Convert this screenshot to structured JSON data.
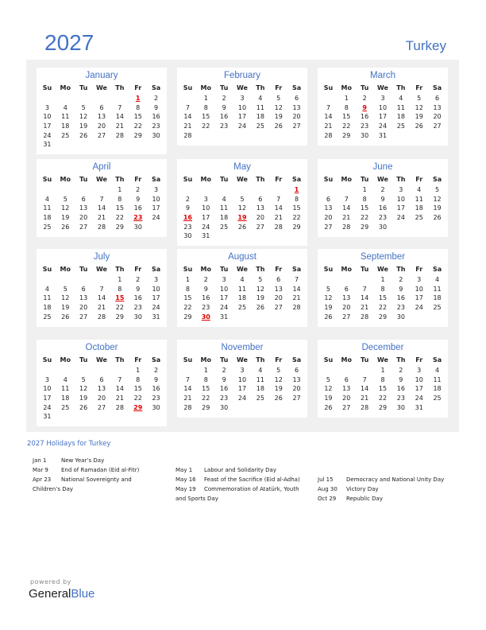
{
  "header": {
    "year": "2027",
    "country": "Turkey"
  },
  "weekdays": [
    "Su",
    "Mo",
    "Tu",
    "We",
    "Th",
    "Fr",
    "Sa"
  ],
  "months": [
    {
      "name": "January",
      "offset": 5,
      "days": 31,
      "holidays": [
        1
      ]
    },
    {
      "name": "February",
      "offset": 1,
      "days": 28,
      "holidays": []
    },
    {
      "name": "March",
      "offset": 1,
      "days": 31,
      "holidays": [
        9
      ]
    },
    {
      "name": "April",
      "offset": 4,
      "days": 30,
      "holidays": [
        23
      ]
    },
    {
      "name": "May",
      "offset": 6,
      "days": 31,
      "holidays": [
        1,
        16,
        19
      ]
    },
    {
      "name": "June",
      "offset": 2,
      "days": 30,
      "holidays": []
    },
    {
      "name": "July",
      "offset": 4,
      "days": 31,
      "holidays": [
        15
      ]
    },
    {
      "name": "August",
      "offset": 0,
      "days": 31,
      "holidays": [
        30
      ]
    },
    {
      "name": "September",
      "offset": 3,
      "days": 30,
      "holidays": []
    },
    {
      "name": "October",
      "offset": 5,
      "days": 31,
      "holidays": [
        29
      ]
    },
    {
      "name": "November",
      "offset": 1,
      "days": 30,
      "holidays": []
    },
    {
      "name": "December",
      "offset": 3,
      "days": 31,
      "holidays": []
    }
  ],
  "holidays_title": "2027 Holidays for Turkey",
  "holiday_columns": [
    [
      {
        "date": "Jan 1",
        "name": "New Year’s Day"
      },
      {
        "date": "Mar 9",
        "name": "End of Ramadan (Eid al-Fitr)"
      },
      {
        "date": "Apr 23",
        "name": "National Sovereignty and Children’s Day"
      }
    ],
    [
      {
        "date": "May 1",
        "name": "Labour and Solidarity Day"
      },
      {
        "date": "May 16",
        "name": "Feast of the Sacrifice (Eid al-Adha)"
      },
      {
        "date": "May 19",
        "name": "Commemoration of Atatürk, Youth and Sports Day"
      }
    ],
    [
      {
        "date": "Jul 15",
        "name": "Democracy and National Unity Day"
      },
      {
        "date": "Aug 30",
        "name": "Victory Day"
      },
      {
        "date": "Oct 29",
        "name": "Republic Day"
      }
    ]
  ],
  "footer": {
    "powered_by": "powered by",
    "brand_general": "General",
    "brand_blue": "Blue"
  },
  "colors": {
    "accent": "#4472c4",
    "holiday": "#e00000",
    "panel": "#f0f0f0"
  }
}
